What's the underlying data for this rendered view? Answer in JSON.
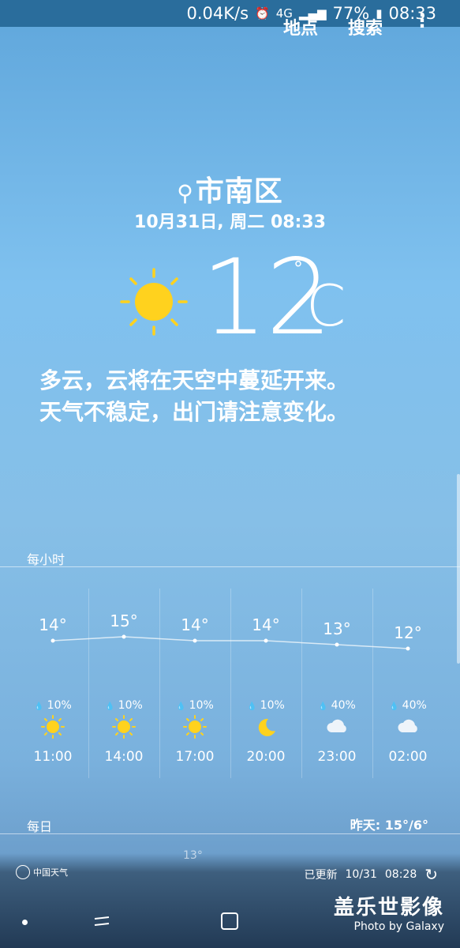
{
  "status_bar": {
    "speed": "0.04K/s",
    "network": "4G",
    "battery": "77%",
    "time": "08:33"
  },
  "top_actions": {
    "location": "地点",
    "search": "搜索",
    "more": "⋮"
  },
  "location": {
    "name": "市南区",
    "datetime": "10月31日, 周二 08:33"
  },
  "current": {
    "temp": "12",
    "degree": "°",
    "unit": "C",
    "icon": "sun-icon",
    "description_line1": "多云，云将在天空中蔓延开来。",
    "description_line2": "天气不稳定，出门请注意变化。"
  },
  "hourly": {
    "label": "每小时",
    "items": [
      {
        "temp": "14°",
        "precip": "10%",
        "icon": "sun",
        "time": "11:00"
      },
      {
        "temp": "15°",
        "precip": "10%",
        "icon": "sun",
        "time": "14:00"
      },
      {
        "temp": "14°",
        "precip": "10%",
        "icon": "sun",
        "time": "17:00"
      },
      {
        "temp": "14°",
        "precip": "10%",
        "icon": "moon",
        "time": "20:00"
      },
      {
        "temp": "13°",
        "precip": "40%",
        "icon": "cloud",
        "time": "23:00"
      },
      {
        "temp": "12°",
        "precip": "40%",
        "icon": "cloud",
        "time": "02:00"
      }
    ]
  },
  "daily": {
    "label": "每日",
    "yesterday": "昨天: 15°/6°",
    "partial": "13°"
  },
  "footer": {
    "provider": "中国天气",
    "updated_label": "已更新",
    "updated_date": "10/31",
    "updated_time": "08:28"
  },
  "watermark": {
    "title": "盖乐世影像",
    "subtitle": "Photo by Galaxy"
  },
  "colors": {
    "sun": "#FFD21E",
    "statusbar": "#2a6d9c"
  }
}
